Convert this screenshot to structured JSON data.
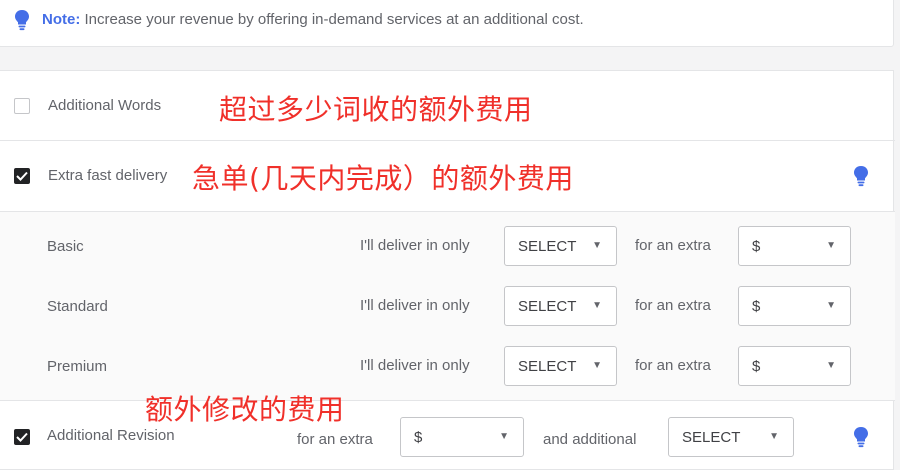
{
  "note": {
    "label": "Note:",
    "text": " Increase your revenue by offering in-demand services at an additional cost."
  },
  "extras": {
    "additional_words": {
      "label": "Additional Words",
      "checked": false,
      "annotation": "超过多少词收的额外费用"
    },
    "extra_fast_delivery": {
      "label": "Extra fast delivery",
      "checked": true,
      "annotation": "急单(几天内完成）的额外费用",
      "tiers": [
        {
          "name": "Basic",
          "deliver_label": "I'll deliver in only",
          "days_value": "SELECT",
          "extra_label": "for an extra",
          "price_value": "$"
        },
        {
          "name": "Standard",
          "deliver_label": "I'll deliver in only",
          "days_value": "SELECT",
          "extra_label": "for an extra",
          "price_value": "$"
        },
        {
          "name": "Premium",
          "deliver_label": "I'll deliver in only",
          "days_value": "SELECT",
          "extra_label": "for an extra",
          "price_value": "$"
        }
      ]
    },
    "additional_revision": {
      "label": "Additional Revision",
      "checked": true,
      "annotation": "额外修改的费用",
      "extra_label": "for an extra",
      "price_value": "$",
      "additional_label": "and additional",
      "count_value": "SELECT"
    }
  },
  "caret": "▼",
  "colors": {
    "accent": "#446ee7",
    "annotation": "#f0302a",
    "checkbox_checked": "#222325"
  },
  "icons": {
    "note": "lightbulb-icon",
    "tip": "lightbulb-icon",
    "check": "check-icon"
  }
}
